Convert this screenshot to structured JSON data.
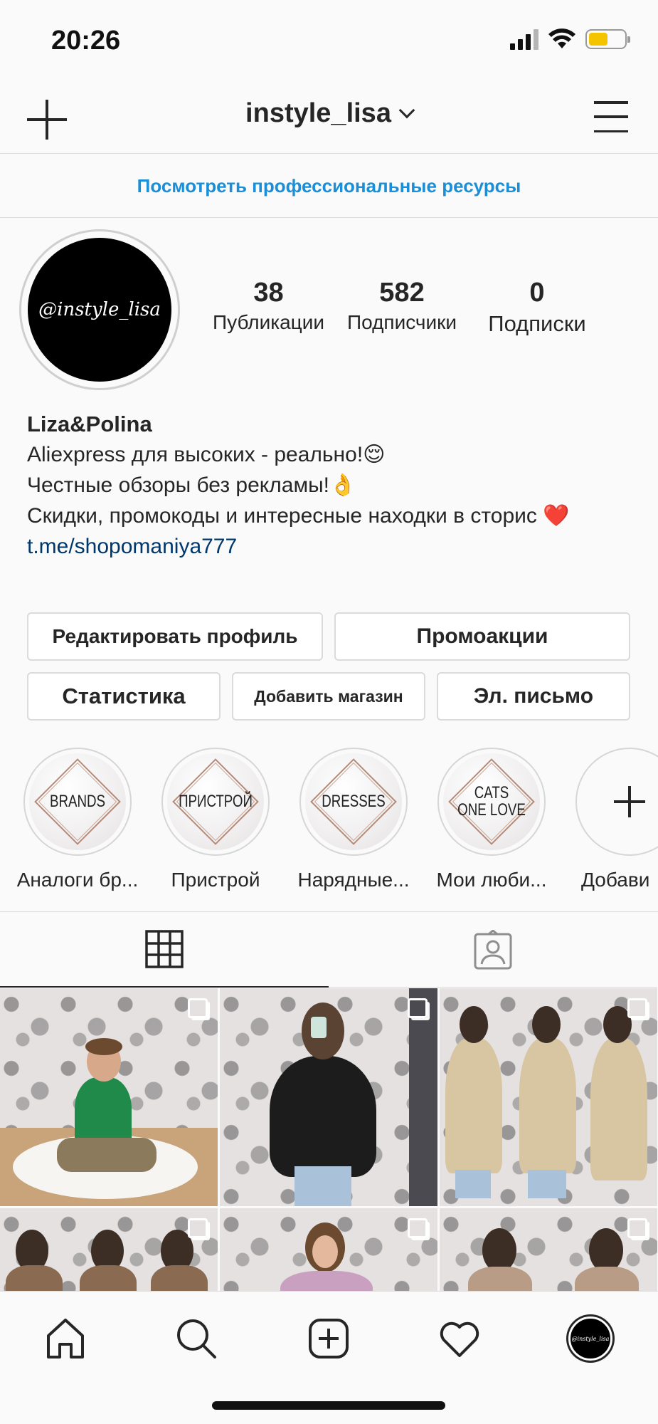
{
  "status_bar": {
    "time": "20:26"
  },
  "header": {
    "username": "instyle_lisa"
  },
  "pro_banner": {
    "label": "Посмотреть профессиональные ресурсы"
  },
  "profile": {
    "avatar_text": "@instyle_lisa",
    "stats": [
      {
        "value": "38",
        "label": "Публикации"
      },
      {
        "value": "582",
        "label": "Подписчики"
      },
      {
        "value": "0",
        "label": "Подписки"
      }
    ],
    "name": "Liza&Polina",
    "bio_lines": [
      "Aliexpress для высоких - реально!😌",
      "Честные обзоры без рекламы!👌",
      "Скидки, промокоды и интересные находки в сторис ❤️"
    ],
    "link": "t.me/shopomaniya777"
  },
  "buttons": {
    "edit_profile": "Редактировать профиль",
    "promotions": "Промоакции",
    "statistics": "Статистика",
    "add_shop": "Добавить магазин",
    "email": "Эл. письмо"
  },
  "highlights": [
    {
      "cover": "BRANDS",
      "label": "Аналоги бр..."
    },
    {
      "cover": "ПРИСТРОЙ",
      "label": "Пристрой"
    },
    {
      "cover": "DRESSES",
      "label": "Нарядные..."
    },
    {
      "cover": "CATS\nONE LOVE",
      "label": "Мои люби..."
    },
    {
      "cover": "",
      "label": "Добави"
    }
  ],
  "tabs": {
    "active": "grid",
    "icons": [
      "grid-icon",
      "tagged-icon"
    ]
  },
  "bottom_nav": {
    "icons": [
      "home-icon",
      "search-icon",
      "new-post-icon",
      "activity-heart-icon",
      "profile-avatar"
    ],
    "avatar_text": "@instyle_lisa"
  },
  "colors": {
    "link_blue": "#1a8fd8",
    "bio_link": "#00376b",
    "battery": "#f5c400"
  }
}
